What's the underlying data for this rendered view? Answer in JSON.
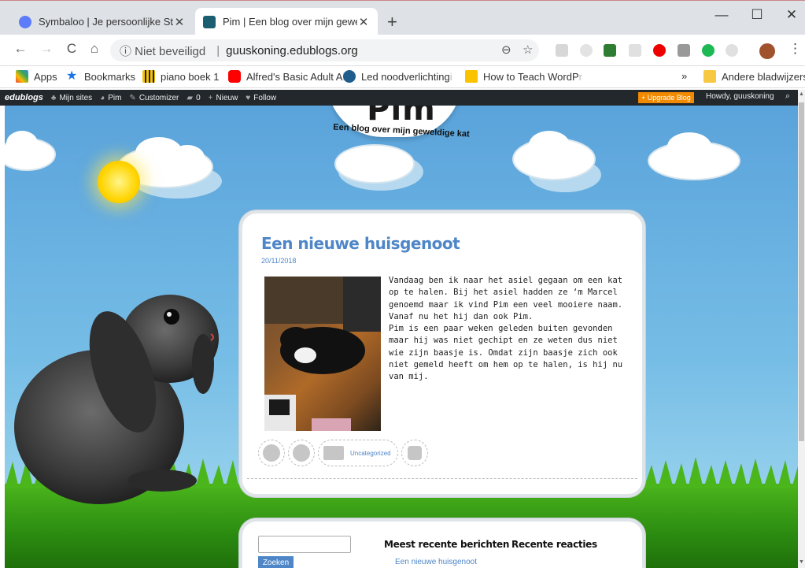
{
  "browser": {
    "tabs": [
      {
        "title": "Symbaloo | Je persoonlijke Startp",
        "favicon_color": "#5c7cfa",
        "active": false
      },
      {
        "title": "Pim | Een blog over mijn geweldi",
        "favicon_color": "#1b5e72",
        "active": true
      }
    ],
    "new_tab_label": "+",
    "window_controls": {
      "minimize": "—",
      "maximize": "☐",
      "close": "✕"
    },
    "nav": {
      "back": "←",
      "forward": "→",
      "reload": "C",
      "home": "⌂"
    },
    "security_label": "ⓘ Niet beveiligd",
    "url": "guuskoning.edublogs.org",
    "separator": "|",
    "zoom_icon": "⊖",
    "star_icon": "☆",
    "menu_icon": "⋮"
  },
  "bookmarks": [
    {
      "label": "Apps",
      "icon": "apps-grid-icon",
      "color": "#ea4335"
    },
    {
      "label": "Bookmarks",
      "icon": "star-icon",
      "color": "#1a73e8"
    },
    {
      "label": "piano boek 1",
      "icon": "piano-icon",
      "color": "#f4c20d"
    },
    {
      "label": "Alfred's Basic Adult A",
      "icon": "youtube-icon",
      "color": "#ff0000"
    },
    {
      "label": "Led noodverlichting",
      "icon": "led-icon",
      "color": "#1f5e8c"
    },
    {
      "label": "How to Teach WordP",
      "icon": "b-icon",
      "color": "#f9c300"
    }
  ],
  "bookmarks_overflow": "»",
  "other_bookmarks": "Andere bladwijzers",
  "adminbar": {
    "logo": "edublogs",
    "items": [
      {
        "icon": "sites-icon",
        "label": "Mijn sites"
      },
      {
        "icon": "dashboard-icon",
        "label": "Pim"
      },
      {
        "icon": "brush-icon",
        "label": "Customizer"
      },
      {
        "icon": "comment-icon",
        "label": "0"
      },
      {
        "icon": "plus-icon",
        "label": "Nieuw"
      },
      {
        "icon": "heart-icon",
        "label": "Follow"
      }
    ],
    "upgrade": "+ Upgrade Blog",
    "howdy": "Howdy, guuskoning"
  },
  "site": {
    "title": "Pim",
    "tagline": "Een blog over mijn geweldige kat"
  },
  "post": {
    "title": "Een nieuwe huisgenoot",
    "date": "20/11/2018",
    "paragraph1": "Vandaag ben ik naar het asiel gegaan om een kat op te halen. Bij het asiel hadden ze ‘m Marcel genoemd maar ik vind Pim een veel mooiere naam. Vanaf nu het hij dan ook Pim.",
    "paragraph2": "Pim is een paar weken geleden buiten gevonden maar hij was niet gechipt en ze weten dus niet wie zijn baasje is. Omdat zijn baasje zich ook niet gemeld heeft om hem op te halen, is hij nu van mij.",
    "category": "Uncategorized"
  },
  "widgets": {
    "search_button": "Zoeken",
    "search_value": "",
    "recent_posts_title": "Meest recente berichten",
    "recent_comments_title": "Recente reacties",
    "recent_posts": [
      "Een nieuwe huisgenoot"
    ]
  },
  "colors": {
    "link_blue": "#4e86c8",
    "adminbar_bg": "#23282d",
    "upgrade_orange": "#f28a00",
    "sky": "#5aa3db",
    "grass": "#4bb51c"
  }
}
